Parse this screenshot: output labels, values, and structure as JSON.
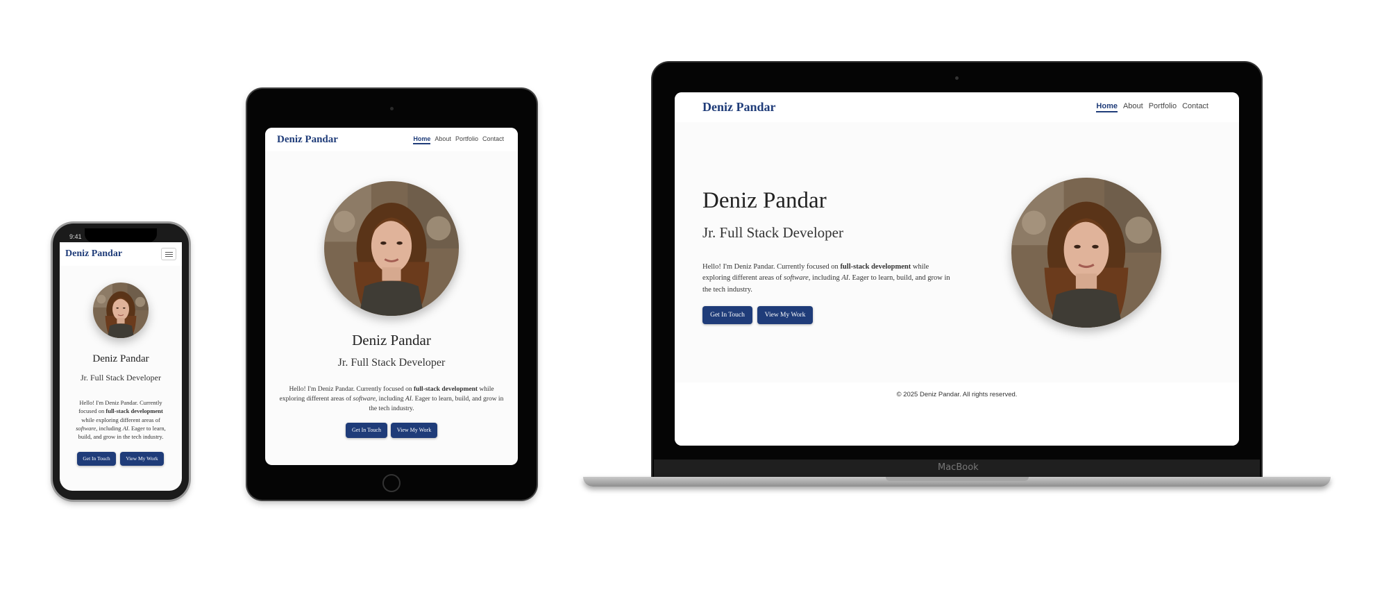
{
  "site": {
    "brand": "Deniz Pandar",
    "nav": [
      "Home",
      "About",
      "Portfolio",
      "Contact"
    ],
    "name": "Deniz Pandar",
    "role": "Jr. Full Stack Developer",
    "bio_intro": "Hello! I'm Deniz Pandar. Currently focused on ",
    "bio_strong": "full-stack development",
    "bio_mid": " while exploring different areas of ",
    "bio_em1": "software",
    "bio_mid2": ", including ",
    "bio_em2": "AI",
    "bio_end": ". Eager to learn, build, and grow in the tech industry.",
    "cta_primary": "Get In Touch",
    "cta_secondary": "View My Work",
    "footer": "© 2025 Deniz Pandar. All rights reserved."
  },
  "phone": {
    "status_time": "9:41"
  },
  "laptop": {
    "model_label": "MacBook"
  },
  "colors": {
    "brand": "#1f3c79",
    "device_frame": "#0a0a0a",
    "page_bg": "#fbfbfb"
  },
  "icons": [
    "hamburger-menu-icon",
    "camera-icon",
    "home-button-icon",
    "portrait-photo"
  ]
}
